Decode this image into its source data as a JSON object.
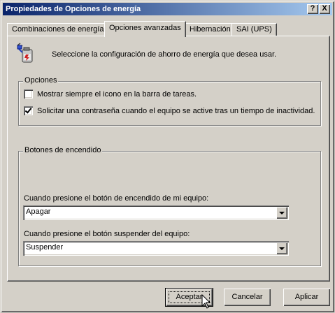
{
  "window": {
    "title": "Propiedades de Opciones de energía",
    "help_glyph": "?",
    "close_glyph": "X"
  },
  "tabs": [
    {
      "label": "Combinaciones de energía",
      "active": false
    },
    {
      "label": "Opciones avanzadas",
      "active": true
    },
    {
      "label": "Hibernación",
      "active": false
    },
    {
      "label": "SAI (UPS)",
      "active": false
    }
  ],
  "intro": {
    "icon": "power-plug-battery-icon",
    "text": "Seleccione la configuración de ahorro de energía que desea usar."
  },
  "options": {
    "legend": "Opciones",
    "checkboxes": [
      {
        "label": "Mostrar siempre el icono en la barra de tareas.",
        "checked": false
      },
      {
        "label": "Solicitar una contraseña cuando el equipo se active tras un tiempo de inactividad.",
        "checked": true
      }
    ]
  },
  "power_buttons": {
    "legend": "Botones de encendido",
    "power_label": "Cuando presione el botón de encendido de mi equipo:",
    "power_value": "Apagar",
    "suspend_label": "Cuando presione el botón suspender del  equipo:",
    "suspend_value": "Suspender"
  },
  "buttons": {
    "ok": "Aceptar",
    "cancel": "Cancelar",
    "apply": "Aplicar"
  },
  "colors": {
    "title_start": "#0a246a",
    "title_end": "#a6caf0",
    "face": "#d4d0c8"
  }
}
